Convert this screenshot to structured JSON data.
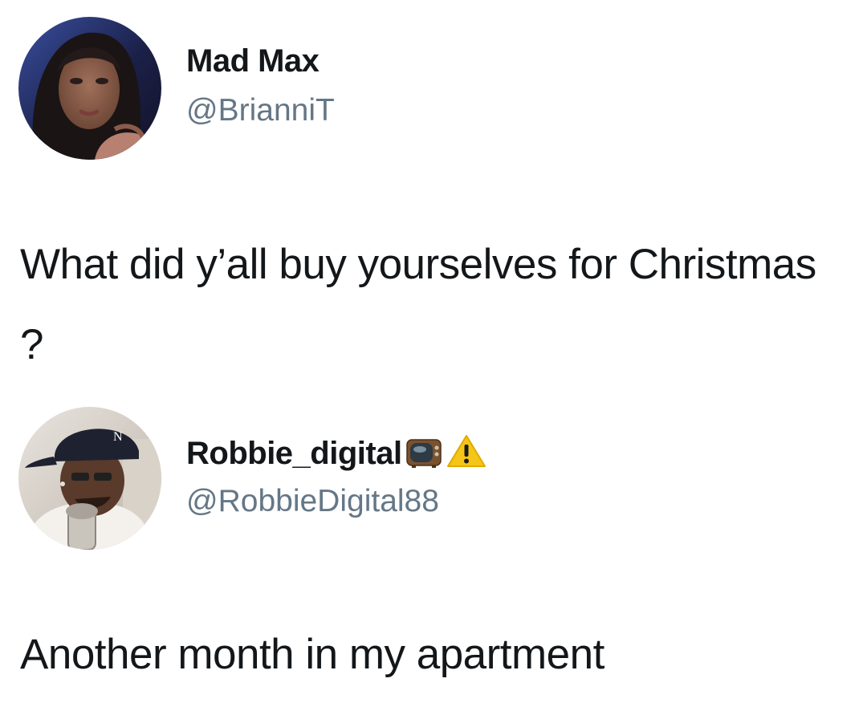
{
  "tweets": [
    {
      "display_name": "Mad Max",
      "handle": "@BrianniT",
      "text": "What did y’all buy yourselves for Christmas ?",
      "avatar_icon": "woman-portrait-avatar"
    },
    {
      "display_name": "Robbie_digital",
      "name_emojis": [
        "television-icon",
        "warning-icon"
      ],
      "handle": "@RobbieDigital88",
      "text": "Another month in my apartment",
      "avatar_icon": "man-cap-microphone-avatar"
    }
  ],
  "colors": {
    "text": "#14171a",
    "handle": "#657786",
    "warning": "#f5c518"
  }
}
